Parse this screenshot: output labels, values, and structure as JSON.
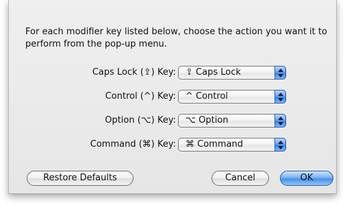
{
  "dialog": {
    "instructions": "For each modifier key listed below, choose the action you want it to perform from the pop-up menu."
  },
  "modifier_rows": [
    {
      "label": "Caps Lock (⇪) Key:",
      "selected": "⇪ Caps Lock"
    },
    {
      "label": "Control (^) Key:",
      "selected": "^ Control"
    },
    {
      "label": "Option (⌥) Key:",
      "selected": "⌥ Option"
    },
    {
      "label": "Command (⌘) Key:",
      "selected": "⌘ Command"
    }
  ],
  "buttons": {
    "restore_defaults": "Restore Defaults",
    "cancel": "Cancel",
    "ok": "OK"
  },
  "colors": {
    "default_button": "#4a8fe4",
    "popup_arrow": "#3f86e0"
  }
}
